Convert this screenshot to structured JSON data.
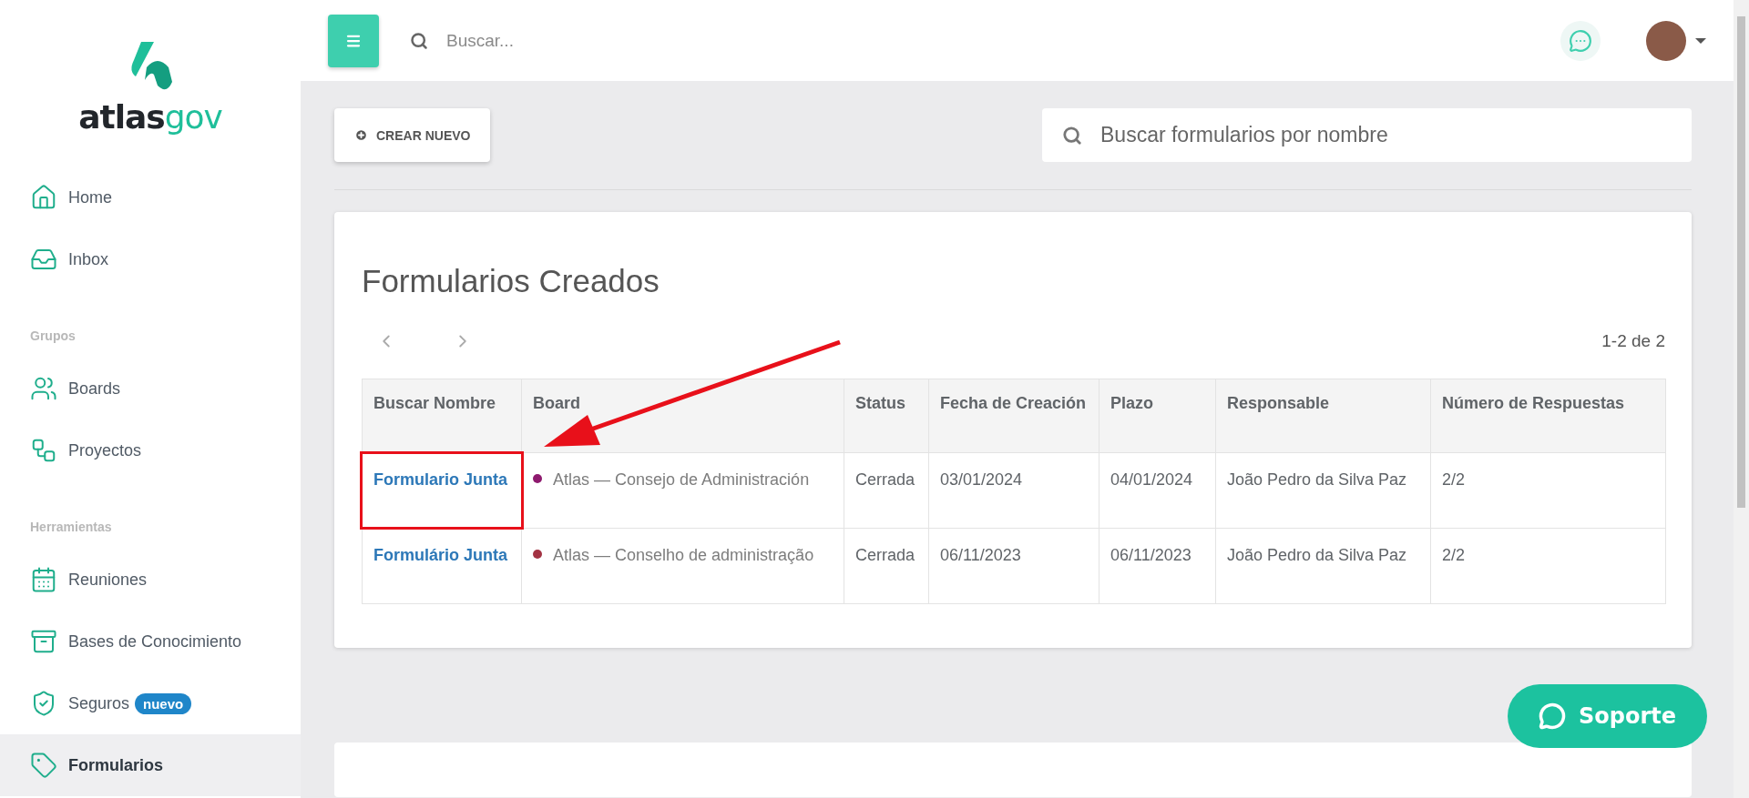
{
  "sidebar": {
    "logo": {
      "main": "atlas",
      "accent": "gov"
    },
    "sections": [
      {
        "items": [
          {
            "label": "Home",
            "selected": false
          },
          {
            "label": "Inbox",
            "selected": false
          }
        ]
      },
      {
        "heading": "Grupos",
        "items": [
          {
            "label": "Boards",
            "selected": false
          },
          {
            "label": "Proyectos",
            "selected": false
          }
        ]
      },
      {
        "heading": "Herramientas",
        "items": [
          {
            "label": "Reuniones",
            "selected": false
          },
          {
            "label": "Bases de Conocimiento",
            "selected": false
          },
          {
            "label": "Seguros",
            "selected": false,
            "badge": "nuevo"
          },
          {
            "label": "Formularios",
            "selected": true
          }
        ]
      }
    ]
  },
  "topbar": {
    "search": {
      "placeholder": "Buscar..."
    }
  },
  "toolbar": {
    "create_button": "CREAR NUEVO",
    "search": {
      "placeholder": "Buscar formularios por nombre"
    }
  },
  "forms_card": {
    "title": "Formularios Creados",
    "pagination": "1-2 de 2",
    "table": {
      "columns": [
        "Buscar Nombre",
        "Board",
        "Status",
        "Fecha de Creación",
        "Plazo",
        "Responsable",
        "Número de Respuestas"
      ],
      "rows": [
        {
          "name": "Formulario Junta",
          "board": {
            "color": "#8e1a6e",
            "name": "Atlas — Consejo de Administración"
          },
          "status": "Cerrada",
          "created": "03/01/2024",
          "deadline": "04/01/2024",
          "owner": "João Pedro da Silva Paz",
          "responses": "2/2",
          "highlighted": true
        },
        {
          "name": "Formulário Junta",
          "board": {
            "color": "#a33343",
            "name": "Atlas — Conselho de administração"
          },
          "status": "Cerrada",
          "created": "06/11/2023",
          "deadline": "06/11/2023",
          "owner": "João Pedro da Silva Paz",
          "responses": "2/2",
          "highlighted": false
        }
      ]
    }
  },
  "support_button": "Soporte"
}
